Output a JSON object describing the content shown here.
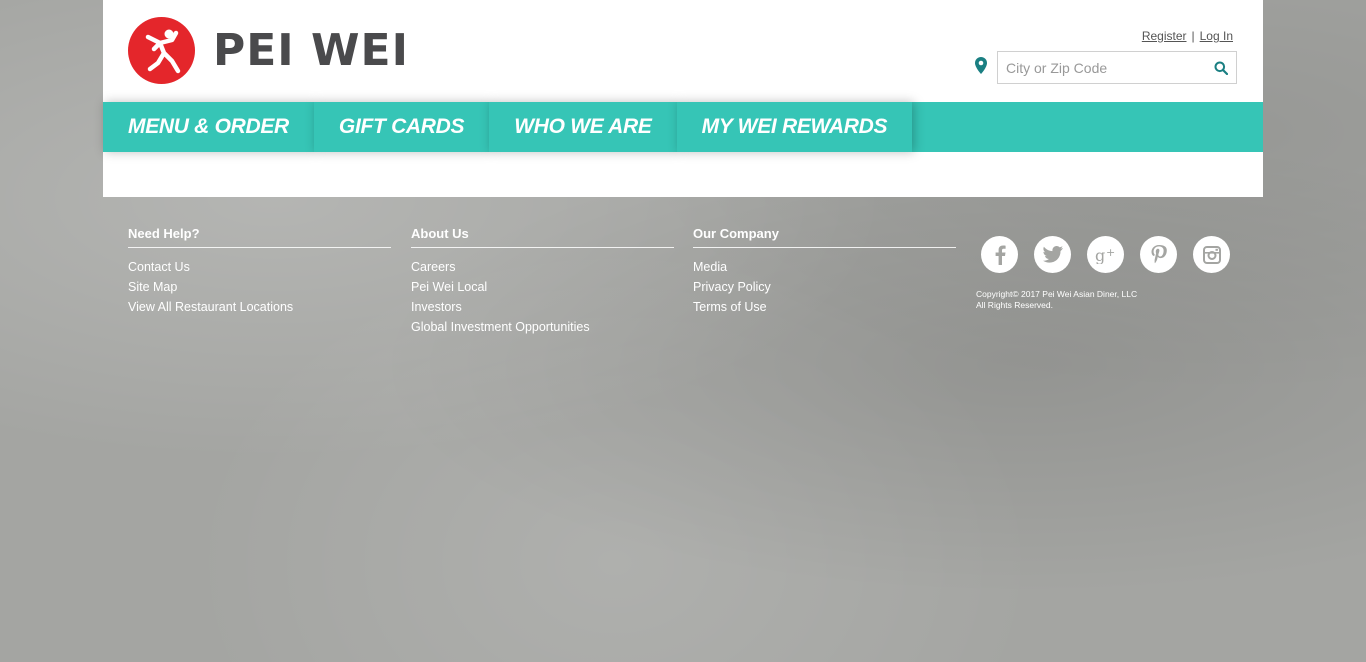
{
  "brand": {
    "name": "PEI WEI",
    "logo_color": "#e4262b",
    "text_color": "#4a4a4c"
  },
  "header": {
    "register_label": "Register",
    "separator": "|",
    "login_label": "Log In",
    "search": {
      "placeholder": "City or Zip Code",
      "value": ""
    },
    "accent": "#1a7f82"
  },
  "nav": {
    "color": "#36c5b6",
    "items": [
      {
        "label": "MENU & ORDER"
      },
      {
        "label": "GIFT CARDS"
      },
      {
        "label": "WHO WE ARE"
      },
      {
        "label": "MY WEI REWARDS"
      }
    ]
  },
  "footer": {
    "columns": [
      {
        "heading": "Need Help?",
        "links": [
          "Contact Us",
          "Site Map",
          "View All Restaurant Locations"
        ]
      },
      {
        "heading": "About Us",
        "links": [
          "Careers",
          "Pei Wei Local",
          "Investors",
          "Global Investment Opportunities"
        ]
      },
      {
        "heading": "Our Company",
        "links": [
          "Media",
          "Privacy Policy",
          "Terms of Use"
        ]
      }
    ],
    "social_icons": [
      "facebook-icon",
      "twitter-icon",
      "google-plus-icon",
      "pinterest-icon",
      "instagram-icon"
    ],
    "copyright_line1": "Copyright© 2017 Pei Wei Asian Diner, LLC",
    "copyright_line2": "All Rights Reserved."
  }
}
